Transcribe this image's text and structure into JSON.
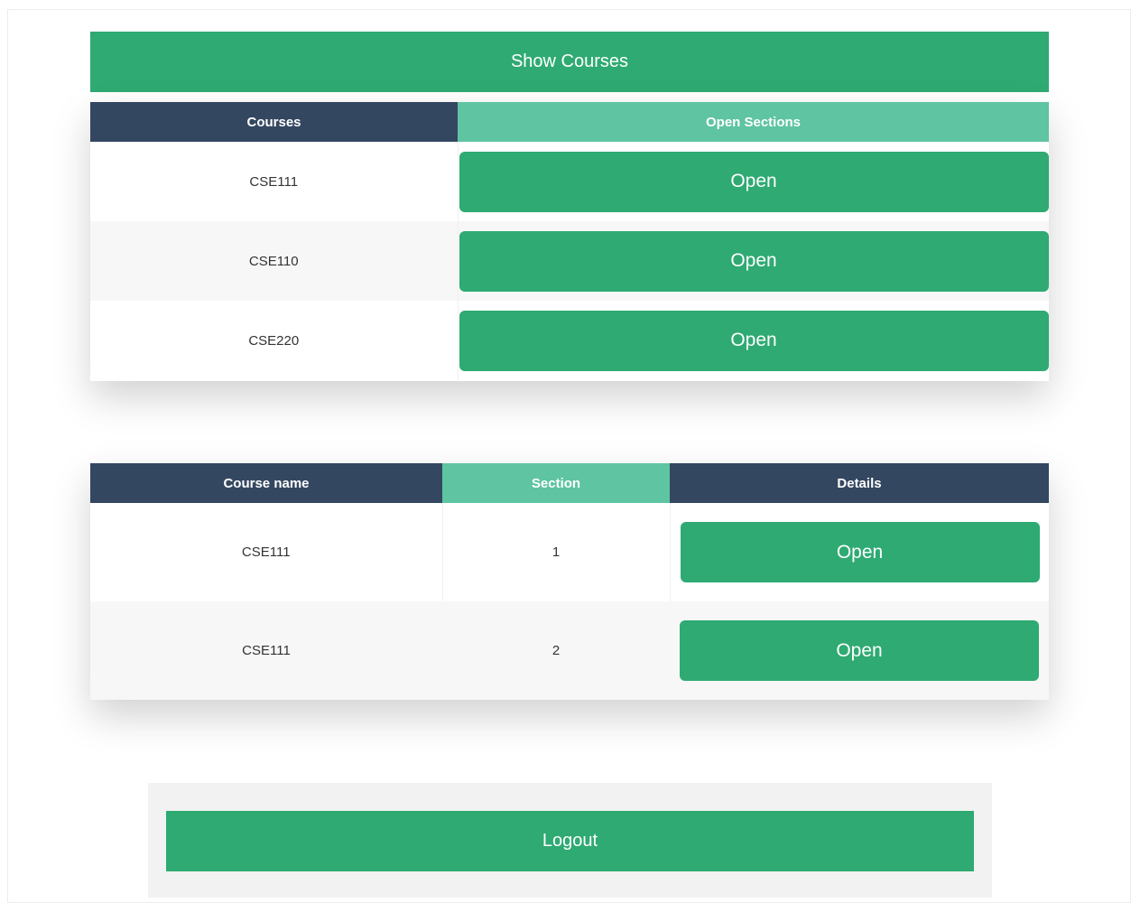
{
  "show_courses": {
    "label": "Show Courses"
  },
  "courses_table": {
    "headers": [
      "Courses",
      "Open Sections"
    ],
    "rows": [
      {
        "course": "CSE111",
        "action": "Open"
      },
      {
        "course": "CSE110",
        "action": "Open"
      },
      {
        "course": "CSE220",
        "action": "Open"
      }
    ]
  },
  "sections_table": {
    "headers": [
      "Course name",
      "Section",
      "Details"
    ],
    "rows": [
      {
        "course": "CSE111",
        "section": "1",
        "action": "Open"
      },
      {
        "course": "CSE111",
        "section": "2",
        "action": "Open"
      }
    ]
  },
  "logout": {
    "label": "Logout"
  },
  "colors": {
    "button_green": "#2eaa72",
    "header_dark": "#344761",
    "header_teal": "#5ec4a2"
  }
}
